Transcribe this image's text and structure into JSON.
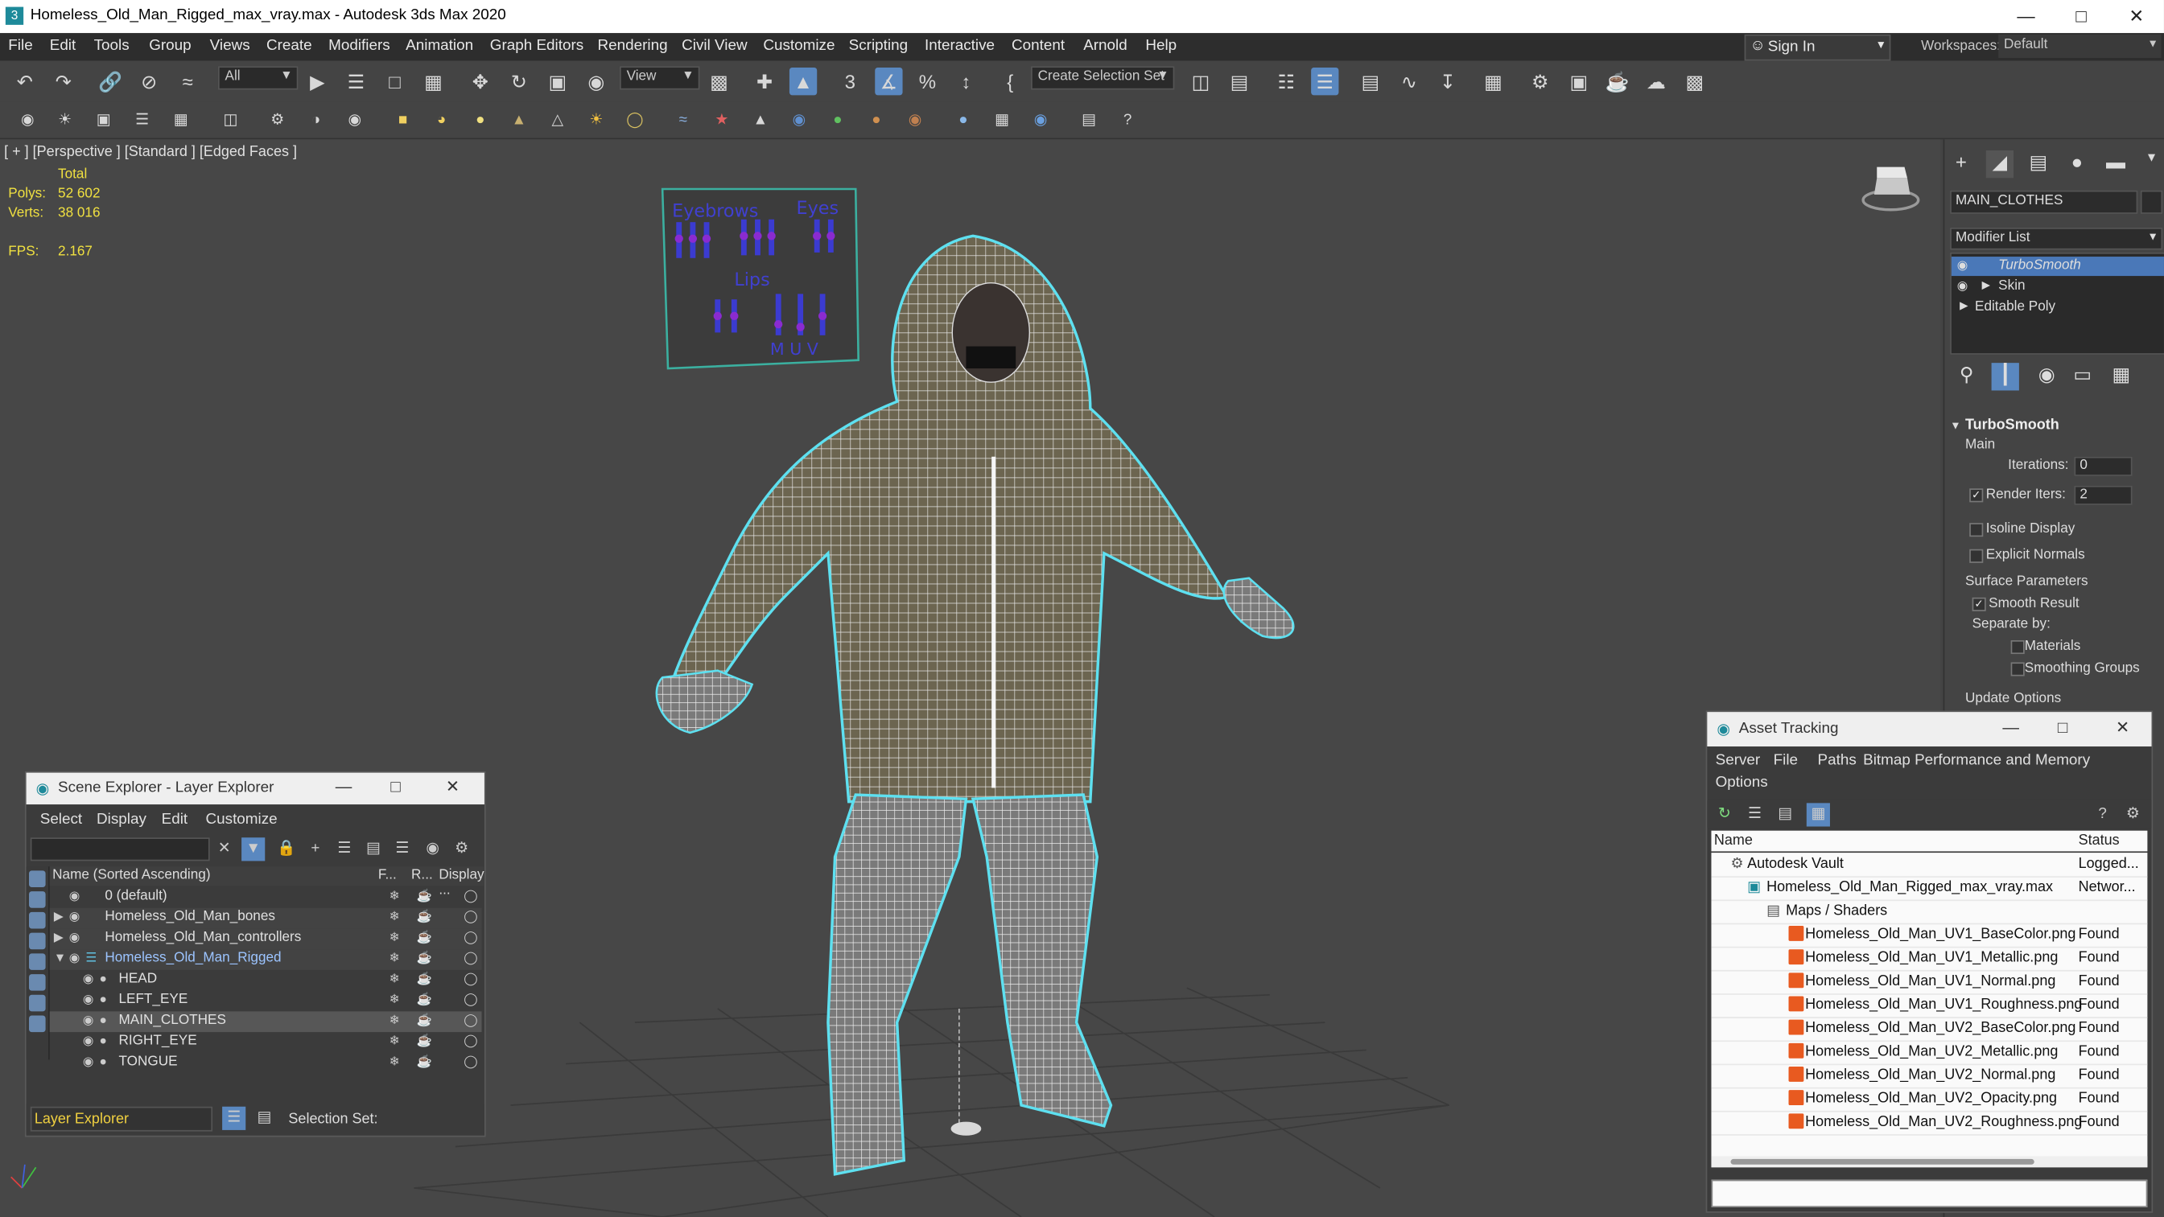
{
  "window": {
    "title": "Homeless_Old_Man_Rigged_max_vray.max - Autodesk 3ds Max 2020",
    "app_icon": "3"
  },
  "menubar": {
    "items": [
      "File",
      "Edit",
      "Tools",
      "Group",
      "Views",
      "Create",
      "Modifiers",
      "Animation",
      "Graph Editors",
      "Rendering",
      "Civil View",
      "Customize",
      "Scripting",
      "Interactive",
      "Content",
      "Arnold",
      "Help"
    ],
    "sign_in": "Sign In",
    "workspaces_label": "Workspaces:",
    "workspace_value": "Default"
  },
  "toolbar": {
    "selection_filter": "All",
    "ref_coord": "View",
    "selection_set": "Create Selection Set"
  },
  "viewport": {
    "label": "[ + ] [Perspective ]  [Standard ]  [Edged Faces ]",
    "stats_header": "Total",
    "polys_label": "Polys:",
    "polys_value": "52 602",
    "verts_label": "Verts:",
    "verts_value": "38 016",
    "fps_label": "FPS:",
    "fps_value": "2.167",
    "board_eyebrows": "Eyebrows",
    "board_eyes": "Eyes",
    "board_lips": "Lips",
    "board_muv": "M U V"
  },
  "command_panel": {
    "object_name": "MAIN_CLOTHES",
    "modifier_list": "Modifier List",
    "stack": [
      "TurboSmooth",
      "Skin",
      "Editable Poly"
    ],
    "rollout_title": "TurboSmooth",
    "main_label": "Main",
    "iterations_label": "Iterations:",
    "iterations_value": "0",
    "render_iters_label": "Render Iters:",
    "render_iters_value": "2",
    "isoline_label": "Isoline Display",
    "explicit_normals_label": "Explicit Normals",
    "surface_params_label": "Surface Parameters",
    "smooth_result_label": "Smooth Result",
    "separate_by_label": "Separate by:",
    "materials_label": "Materials",
    "smoothing_groups_label": "Smoothing Groups",
    "update_options_label": "Update Options"
  },
  "scene_explorer": {
    "title": "Scene Explorer - Layer Explorer",
    "menu": [
      "Select",
      "Display",
      "Edit",
      "Customize"
    ],
    "columns": [
      "Name (Sorted Ascending)",
      "F...",
      "R...",
      "Display ..."
    ],
    "rows": [
      {
        "name": "0 (default)"
      },
      {
        "name": "Homeless_Old_Man_bones"
      },
      {
        "name": "Homeless_Old_Man_controllers"
      },
      {
        "name": "Homeless_Old_Man_Rigged"
      },
      {
        "name": "HEAD"
      },
      {
        "name": "LEFT_EYE"
      },
      {
        "name": "MAIN_CLOTHES"
      },
      {
        "name": "RIGHT_EYE"
      },
      {
        "name": "TONGUE"
      }
    ],
    "bottom_layer": "Layer Explorer",
    "selection_set_label": "Selection Set:"
  },
  "asset_tracking": {
    "title": "Asset Tracking",
    "menu": [
      "Server",
      "File",
      "Paths",
      "Bitmap Performance and Memory",
      "Options"
    ],
    "col_name": "Name",
    "col_status": "Status",
    "rows": [
      {
        "name": "Autodesk Vault",
        "status": "Logged..."
      },
      {
        "name": "Homeless_Old_Man_Rigged_max_vray.max",
        "status": "Networ..."
      },
      {
        "name": "Maps / Shaders",
        "status": ""
      },
      {
        "name": "Homeless_Old_Man_UV1_BaseColor.png",
        "status": "Found"
      },
      {
        "name": "Homeless_Old_Man_UV1_Metallic.png",
        "status": "Found"
      },
      {
        "name": "Homeless_Old_Man_UV1_Normal.png",
        "status": "Found"
      },
      {
        "name": "Homeless_Old_Man_UV1_Roughness.png",
        "status": "Found"
      },
      {
        "name": "Homeless_Old_Man_UV2_BaseColor.png",
        "status": "Found"
      },
      {
        "name": "Homeless_Old_Man_UV2_Metallic.png",
        "status": "Found"
      },
      {
        "name": "Homeless_Old_Man_UV2_Normal.png",
        "status": "Found"
      },
      {
        "name": "Homeless_Old_Man_UV2_Opacity.png",
        "status": "Found"
      },
      {
        "name": "Homeless_Old_Man_UV2_Roughness.png",
        "status": "Found"
      }
    ]
  },
  "colors": {
    "selection_blue": "#4a78b8",
    "stats_yellow": "#f0e040",
    "wire_cyan": "#5ee0f0"
  }
}
